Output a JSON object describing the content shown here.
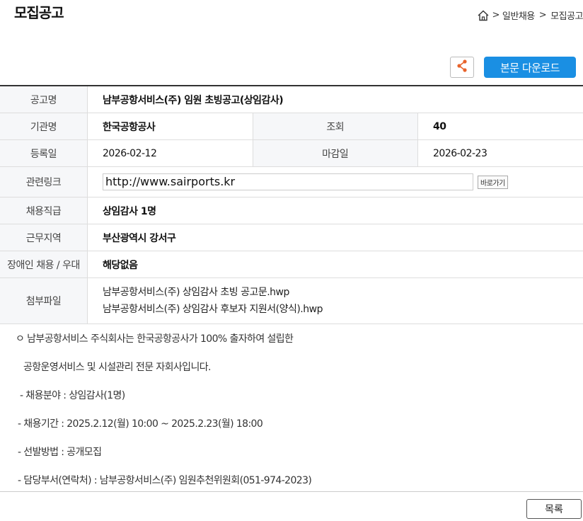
{
  "page_title": "모집공고",
  "breadcrumb": {
    "sep1": ">",
    "item1": "일반채용",
    "sep2": ">",
    "item2": "모집공고"
  },
  "actions": {
    "download_label": "본문 다운로드"
  },
  "info": {
    "title_label": "공고명",
    "title_value": "남부공항서비스(주) 임원 초빙공고(상임감사)",
    "org_label": "기관명",
    "org_value": "한국공항공사",
    "views_label": "조회",
    "views_value": "40",
    "reg_label": "등록일",
    "reg_value": "2026-02-12",
    "deadline_label": "마감일",
    "deadline_value": "2026-02-23",
    "link_label": "관련링크",
    "link_value": "http://www.sairports.kr",
    "go_label": "바로가기",
    "rank_label": "채용직급",
    "rank_value": "상임감사 1명",
    "region_label": "근무지역",
    "region_value": "부산광역시 강서구",
    "disabled_label": "장애인 채용 / 우대",
    "disabled_value": "해당없음",
    "files_label": "첨부파일",
    "files": [
      "남부공항서비스(주) 상임감사 초빙 공고문.hwp",
      "남부공항서비스(주) 상임감사 후보자 지원서(양식).hwp"
    ]
  },
  "body_lines": [
    "ㅇ 남부공항서비스 주식회사는 한국공항공사가 100% 출자하여 설립한",
    "공항운영서비스 및 시설관리 전문 자회사입니다.",
    "- 채용분야 : 상임감사(1명)",
    "- 채용기간 : 2025.2.12(월) 10:00 ~ 2025.2.23(월) 18:00",
    "- 선발방법 : 공개모집",
    "- 담당부서(연락처) : 남부공항서비스(주) 임원추천위원회(051-974-2023)"
  ],
  "list_button": "목록"
}
